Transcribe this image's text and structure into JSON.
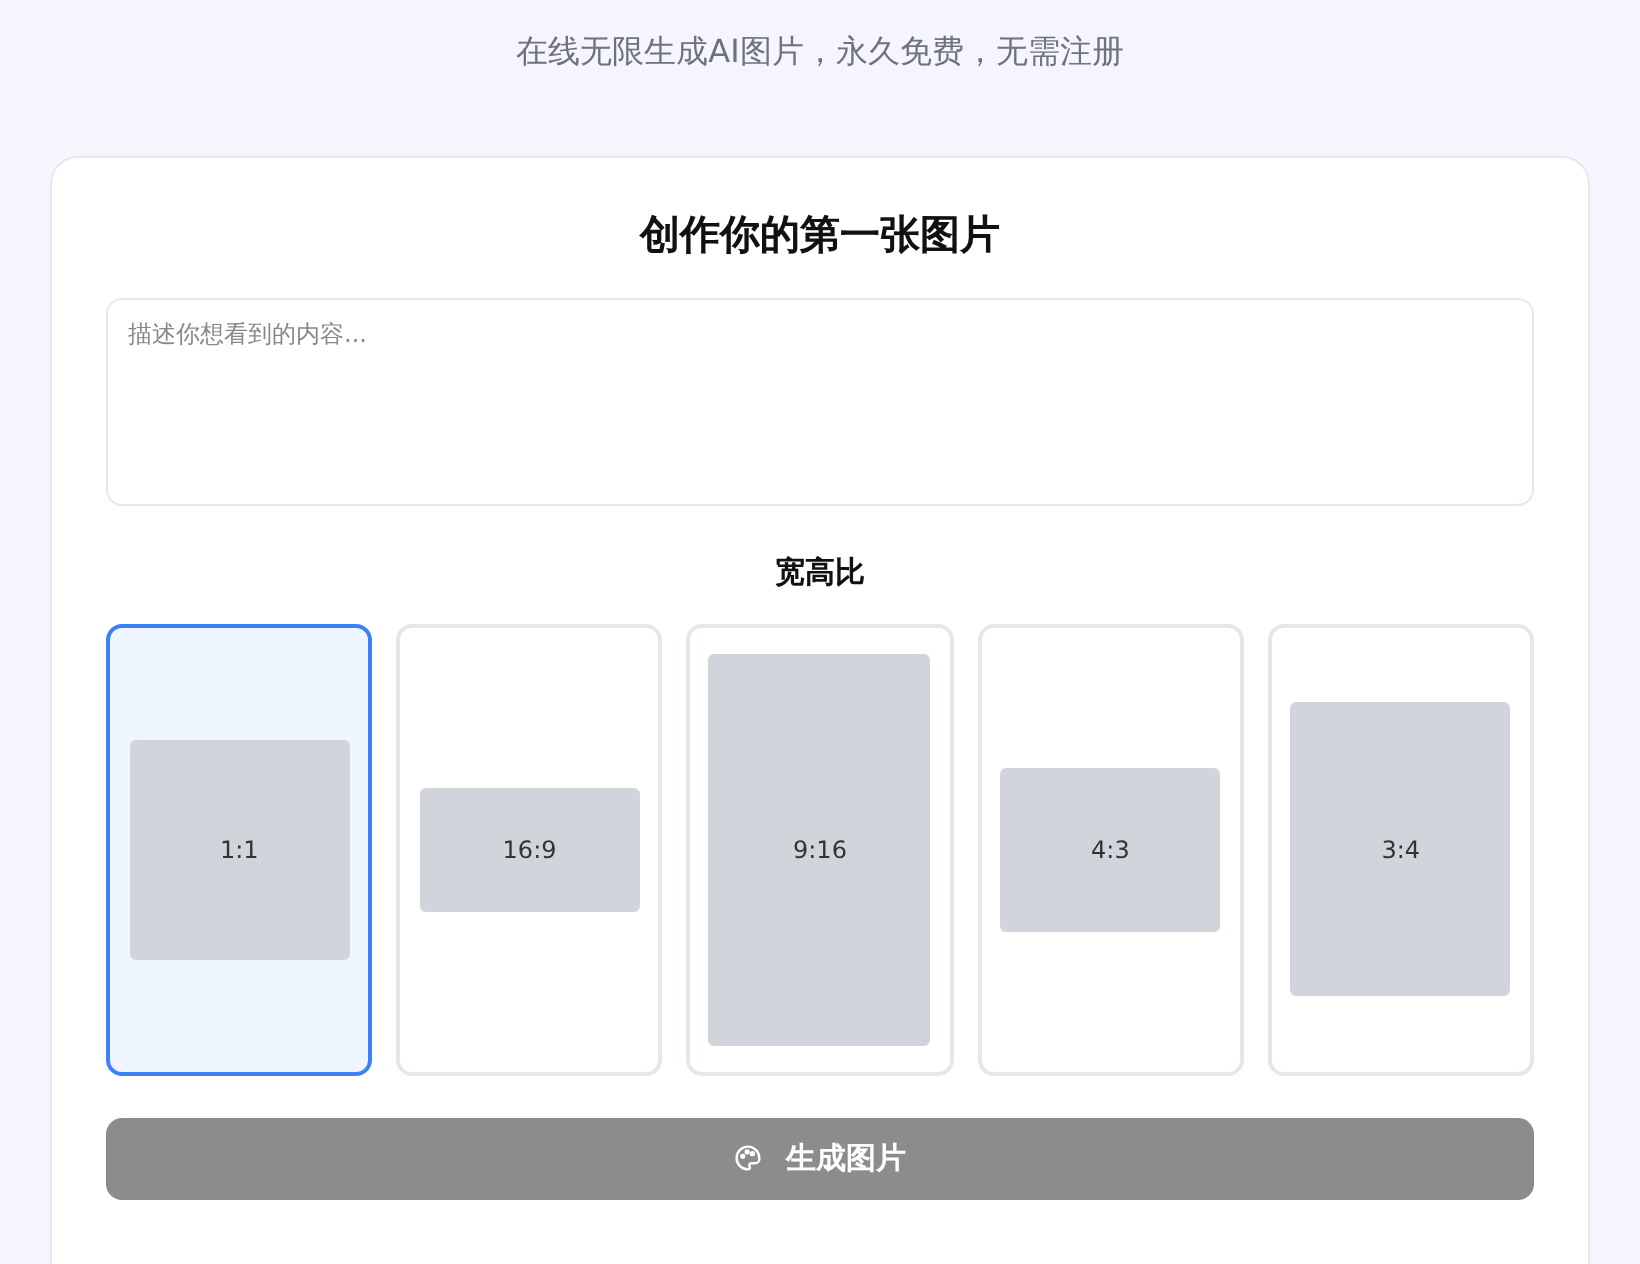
{
  "subtitle": "在线无限生成AI图片，永久免费，无需注册",
  "card": {
    "title": "创作你的第一张图片",
    "prompt": {
      "placeholder": "描述你想看到的内容..."
    },
    "ratio_label": "宽高比",
    "ratios": [
      {
        "label": "1:1",
        "kind": "square",
        "selected": true
      },
      {
        "label": "16:9",
        "kind": "wide",
        "selected": false
      },
      {
        "label": "9:16",
        "kind": "tall",
        "selected": false
      },
      {
        "label": "4:3",
        "kind": "landscape",
        "selected": false
      },
      {
        "label": "3:4",
        "kind": "portrait",
        "selected": false
      }
    ],
    "generate_button": {
      "label": "生成图片",
      "disabled": true
    }
  }
}
